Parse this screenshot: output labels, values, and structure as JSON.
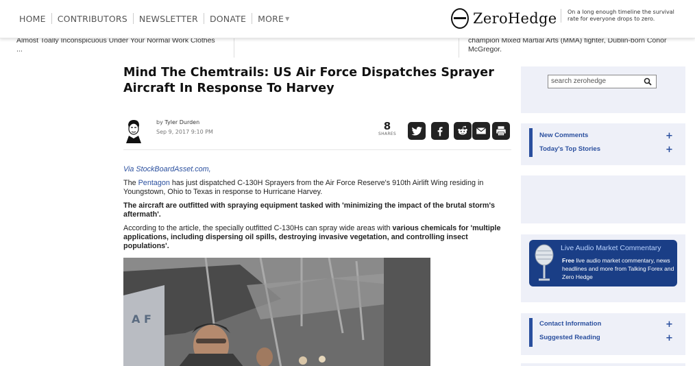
{
  "nav": {
    "items": [
      {
        "label": "HOME"
      },
      {
        "label": "CONTRIBUTORS"
      },
      {
        "label": "NEWSLETTER"
      },
      {
        "label": "DONATE"
      },
      {
        "label": "MORE"
      }
    ]
  },
  "logo": {
    "text": "ZeroHedge"
  },
  "tagline": "On a long enough timeline the survival rate for everyone drops to zero.",
  "teasers": {
    "left": "Almost Toally Inconspicuous Under Your Normal Work Clothes ...",
    "right": "champion Mixed Martial Arts (MMA) fighter, Dublin-born Conor McGregor."
  },
  "article": {
    "title": "Mind The Chemtrails: US Air Force Dispatches Sprayer Aircraft In Response To Harvey",
    "author_prefix": "by",
    "author": "Tyler Durden",
    "date": "Sep 9, 2017 9:10 PM",
    "shares_count": "8",
    "shares_label": "SHARES",
    "via": "Via StockBoardAsset.com,",
    "p1_before": "The ",
    "p1_link": "Pentagon",
    "p1_after": " has just dispatched C-130H Sprayers from the Air Force Reserve's 910th Airlift Wing residing in Youngstown, Ohio to Texas in response to Hurricane Harvey.",
    "p2": "The aircraft are outfitted with spraying equipment tasked with 'minimizing the impact of the brutal storm's aftermath'.",
    "p3_plain": "According to the article, the specially outfitted C-130Hs can spray wide areas with ",
    "p3_bold": "various chemicals for 'multiple applications, including dispersing oil spills, destroying invasive vegetation, and controlling insect populations'."
  },
  "social": {
    "icons": [
      "twitter-icon",
      "facebook-icon",
      "reddit-icon",
      "email-icon",
      "print-icon"
    ],
    "color": "#222222"
  },
  "sidebar": {
    "search_placeholder": "search zerohedge",
    "group1": [
      {
        "label": "New Comments"
      },
      {
        "label": "Today's Top Stories"
      }
    ],
    "audio": {
      "title": "Live Audio Market Commentary",
      "desc_bold": "Free",
      "desc_rest": " live audio market commentary, news headlines and more from Talking Forex and Zero Hedge"
    },
    "group2": [
      {
        "label": "Contact Information"
      },
      {
        "label": "Suggested Reading"
      }
    ],
    "plus": "+"
  },
  "colors": {
    "accent": "#2a4f9e",
    "sidebar_bg": "#eef0f8"
  }
}
